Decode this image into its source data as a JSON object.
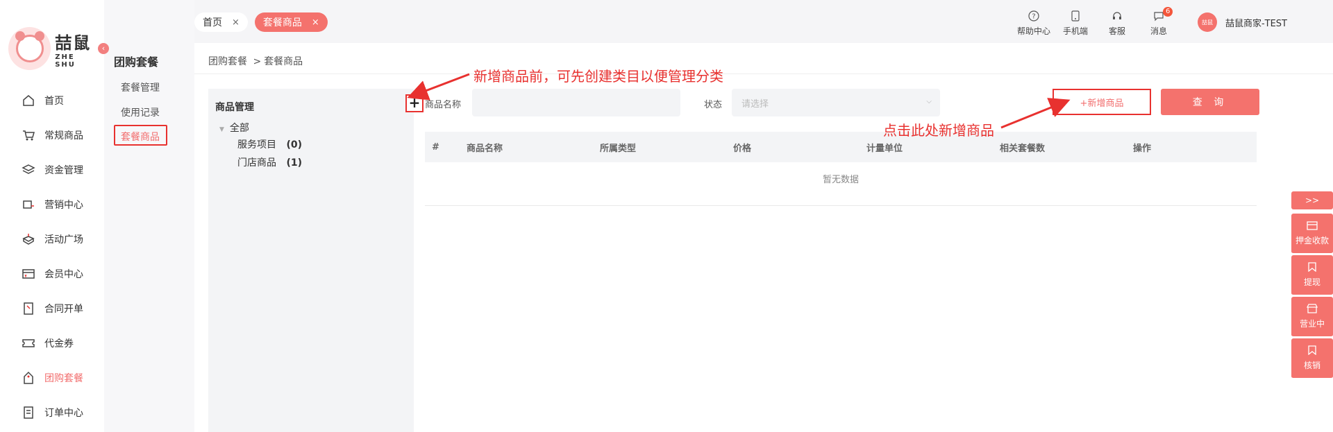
{
  "brand": {
    "name_cn": "喆鼠",
    "name_en": "ZHE SHU"
  },
  "sidebar": {
    "items": [
      {
        "label": "首页",
        "icon": "home-icon"
      },
      {
        "label": "常规商品",
        "icon": "cart-icon"
      },
      {
        "label": "资金管理",
        "icon": "layers-icon"
      },
      {
        "label": "营销中心",
        "icon": "marketing-icon"
      },
      {
        "label": "活动广场",
        "icon": "activity-icon"
      },
      {
        "label": "会员中心",
        "icon": "vip-card-icon"
      },
      {
        "label": "合同开单",
        "icon": "contract-icon"
      },
      {
        "label": "代金券",
        "icon": "coupon-icon"
      },
      {
        "label": "团购套餐",
        "icon": "tag-icon",
        "active": true
      },
      {
        "label": "订单中心",
        "icon": "order-icon"
      }
    ]
  },
  "subbar": {
    "title": "团购套餐",
    "items": [
      "套餐管理",
      "使用记录",
      "套餐商品"
    ]
  },
  "tabs": [
    {
      "label": "首页",
      "close": "×"
    },
    {
      "label": "套餐商品",
      "close": "×",
      "active": true
    }
  ],
  "topbar": {
    "help": "帮助中心",
    "mobile": "手机端",
    "service": "客服",
    "messages": "消息",
    "message_count": "6",
    "user_name": "喆鼠商家-TEST",
    "avatar_text": "喆鼠"
  },
  "breadcrumb": {
    "parent": "团购套餐",
    "sep": ">",
    "current": "套餐商品"
  },
  "tree": {
    "title": "商品管理",
    "add": "+",
    "root": "全部",
    "children": [
      {
        "label": "服务项目",
        "count": "(0)"
      },
      {
        "label": "门店商品",
        "count": "(1)"
      }
    ]
  },
  "filters": {
    "name_label": "商品名称",
    "name_value": "",
    "status_label": "状态",
    "status_placeholder": "请选择"
  },
  "buttons": {
    "add_product": "+新增商品",
    "query": "查 询"
  },
  "table": {
    "columns": [
      "#",
      "商品名称",
      "所属类型",
      "价格",
      "计量单位",
      "相关套餐数",
      "操作"
    ],
    "empty_text": "暂无数据"
  },
  "annotations": {
    "category_tip": "新增商品前，可先创建类目以便管理分类",
    "add_tip": "点击此处新增商品"
  },
  "right_bar": {
    "toggle": ">>",
    "items": [
      "押金收款",
      "提现",
      "营业中",
      "核销"
    ]
  },
  "colors": {
    "accent": "#f4726d",
    "annotation": "#e8312f"
  }
}
